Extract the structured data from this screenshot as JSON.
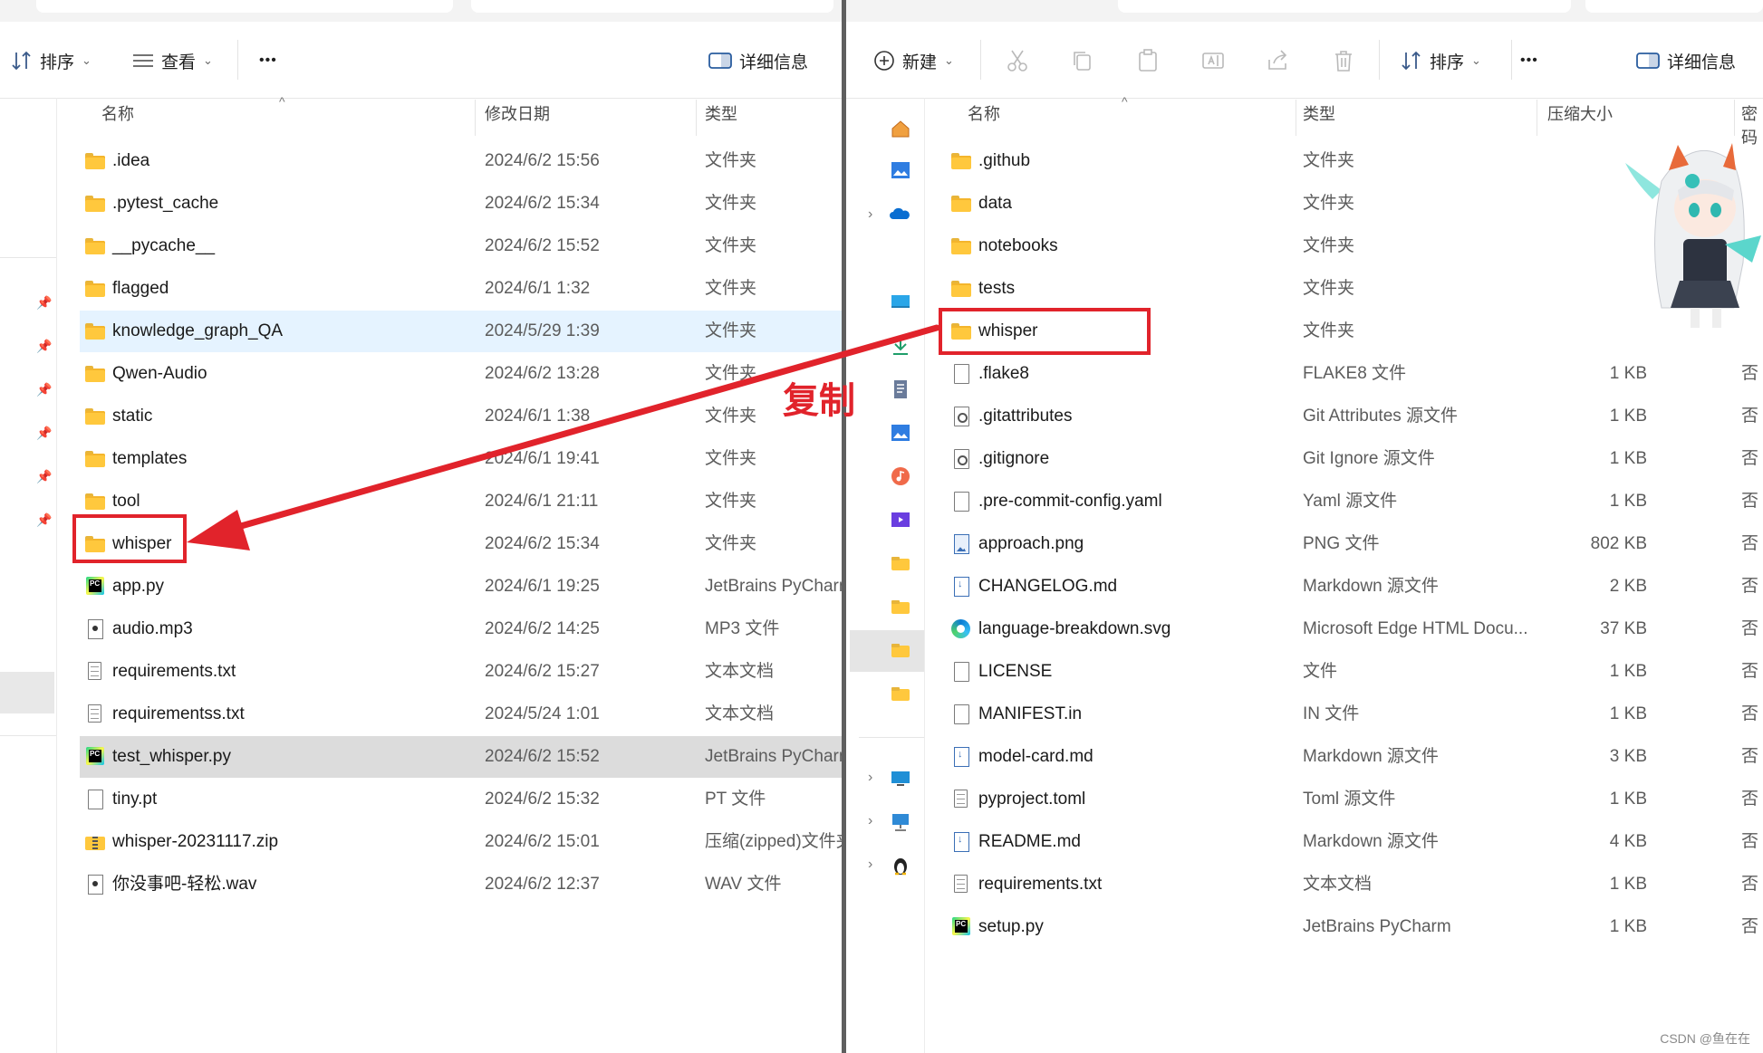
{
  "left": {
    "toolbar": {
      "sort_label": "排序",
      "view_label": "查看",
      "more_label": "•••",
      "details_label": "详细信息"
    },
    "columns": {
      "name": "名称",
      "modified": "修改日期",
      "type": "类型"
    },
    "files": [
      {
        "name": ".idea",
        "date": "2024/6/2 15:56",
        "type": "文件夹",
        "icon": "folder"
      },
      {
        "name": ".pytest_cache",
        "date": "2024/6/2 15:34",
        "type": "文件夹",
        "icon": "folder"
      },
      {
        "name": "__pycache__",
        "date": "2024/6/2 15:52",
        "type": "文件夹",
        "icon": "folder"
      },
      {
        "name": "flagged",
        "date": "2024/6/1 1:32",
        "type": "文件夹",
        "icon": "folder"
      },
      {
        "name": "knowledge_graph_QA",
        "date": "2024/5/29 1:39",
        "type": "文件夹",
        "icon": "folder",
        "state": "selected"
      },
      {
        "name": "Qwen-Audio",
        "date": "2024/6/2 13:28",
        "type": "文件夹",
        "icon": "folder"
      },
      {
        "name": "static",
        "date": "2024/6/1 1:38",
        "type": "文件夹",
        "icon": "folder"
      },
      {
        "name": "templates",
        "date": "2024/6/1 19:41",
        "type": "文件夹",
        "icon": "folder"
      },
      {
        "name": "tool",
        "date": "2024/6/1 21:11",
        "type": "文件夹",
        "icon": "folder"
      },
      {
        "name": "whisper",
        "date": "2024/6/2 15:34",
        "type": "文件夹",
        "icon": "folder"
      },
      {
        "name": "app.py",
        "date": "2024/6/1 19:25",
        "type": "JetBrains PyCharm",
        "icon": "pycharm"
      },
      {
        "name": "audio.mp3",
        "date": "2024/6/2 14:25",
        "type": "MP3 文件",
        "icon": "media"
      },
      {
        "name": "requirements.txt",
        "date": "2024/6/2 15:27",
        "type": "文本文档",
        "icon": "text"
      },
      {
        "name": "requirementss.txt",
        "date": "2024/5/24 1:01",
        "type": "文本文档",
        "icon": "text"
      },
      {
        "name": "test_whisper.py",
        "date": "2024/6/2 15:52",
        "type": "JetBrains PyCharm",
        "icon": "pycharm",
        "state": "hover"
      },
      {
        "name": "tiny.pt",
        "date": "2024/6/2 15:32",
        "type": "PT 文件",
        "icon": "blank"
      },
      {
        "name": "whisper-20231117.zip",
        "date": "2024/6/2 15:01",
        "type": "压缩(zipped)文件夹",
        "icon": "zip"
      },
      {
        "name": "你没事吧-轻松.wav",
        "date": "2024/6/2 12:37",
        "type": "WAV 文件",
        "icon": "media"
      }
    ]
  },
  "right": {
    "toolbar": {
      "new_label": "新建",
      "sort_label": "排序",
      "more_label": "•••",
      "details_label": "详细信息"
    },
    "columns": {
      "name": "名称",
      "type": "类型",
      "compressed_size": "压缩大小",
      "password": "密码"
    },
    "files": [
      {
        "name": ".github",
        "type": "文件夹",
        "size": "",
        "pw": "",
        "icon": "folder"
      },
      {
        "name": "data",
        "type": "文件夹",
        "size": "",
        "pw": "",
        "icon": "folder"
      },
      {
        "name": "notebooks",
        "type": "文件夹",
        "size": "",
        "pw": "",
        "icon": "folder"
      },
      {
        "name": "tests",
        "type": "文件夹",
        "size": "",
        "pw": "",
        "icon": "folder"
      },
      {
        "name": "whisper",
        "type": "文件夹",
        "size": "",
        "pw": "",
        "icon": "folder"
      },
      {
        "name": ".flake8",
        "type": "FLAKE8 文件",
        "size": "1 KB",
        "pw": "否",
        "icon": "blank"
      },
      {
        "name": ".gitattributes",
        "type": "Git Attributes 源文件",
        "size": "1 KB",
        "pw": "否",
        "icon": "gear"
      },
      {
        "name": ".gitignore",
        "type": "Git Ignore 源文件",
        "size": "1 KB",
        "pw": "否",
        "icon": "gear"
      },
      {
        "name": ".pre-commit-config.yaml",
        "type": "Yaml 源文件",
        "size": "1 KB",
        "pw": "否",
        "icon": "blank"
      },
      {
        "name": "approach.png",
        "type": "PNG 文件",
        "size": "802 KB",
        "pw": "否",
        "icon": "image"
      },
      {
        "name": "CHANGELOG.md",
        "type": "Markdown 源文件",
        "size": "2 KB",
        "pw": "否",
        "icon": "markdown"
      },
      {
        "name": "language-breakdown.svg",
        "type": "Microsoft Edge HTML Docu...",
        "size": "37 KB",
        "pw": "否",
        "icon": "edge"
      },
      {
        "name": "LICENSE",
        "type": "文件",
        "size": "1 KB",
        "pw": "否",
        "icon": "blank"
      },
      {
        "name": "MANIFEST.in",
        "type": "IN 文件",
        "size": "1 KB",
        "pw": "否",
        "icon": "blank"
      },
      {
        "name": "model-card.md",
        "type": "Markdown 源文件",
        "size": "3 KB",
        "pw": "否",
        "icon": "markdown"
      },
      {
        "name": "pyproject.toml",
        "type": "Toml 源文件",
        "size": "1 KB",
        "pw": "否",
        "icon": "text"
      },
      {
        "name": "README.md",
        "type": "Markdown 源文件",
        "size": "4 KB",
        "pw": "否",
        "icon": "markdown"
      },
      {
        "name": "requirements.txt",
        "type": "文本文档",
        "size": "1 KB",
        "pw": "否",
        "icon": "text"
      },
      {
        "name": "setup.py",
        "type": "JetBrains PyCharm",
        "size": "1 KB",
        "pw": "否",
        "icon": "pycharm"
      }
    ]
  },
  "annotation": {
    "label": "复制",
    "color": "#e1232b"
  },
  "watermark": "CSDN @鱼在在"
}
